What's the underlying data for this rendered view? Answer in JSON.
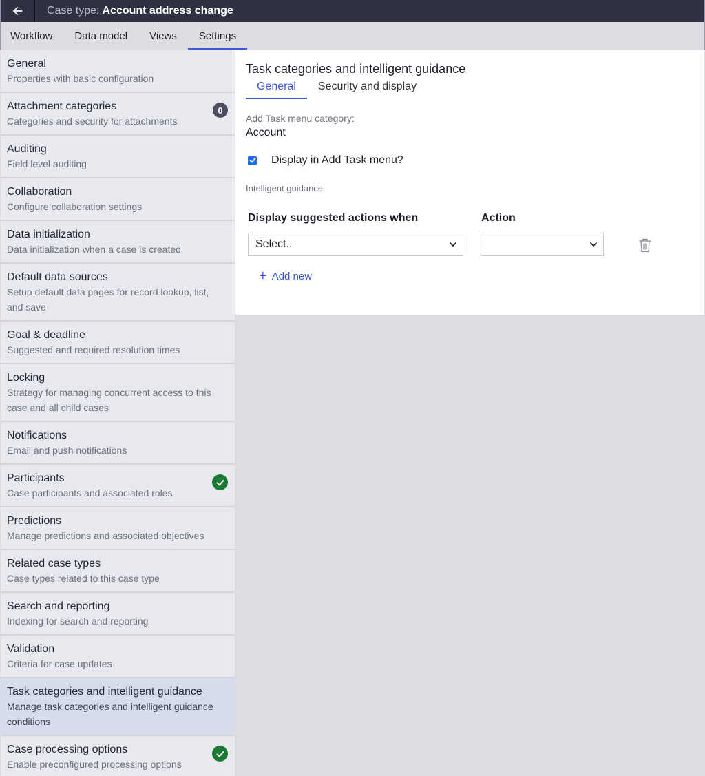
{
  "header": {
    "case_type_label": "Case type:",
    "case_type_name": "Account address change",
    "back_icon": "arrow-left-icon"
  },
  "tabs": [
    {
      "label": "Workflow",
      "active": false
    },
    {
      "label": "Data model",
      "active": false
    },
    {
      "label": "Views",
      "active": false
    },
    {
      "label": "Settings",
      "active": true
    }
  ],
  "sidebar": {
    "items": [
      {
        "title": "General",
        "desc": "Properties with basic configuration"
      },
      {
        "title": "Attachment categories",
        "desc": "Categories and security for attachments",
        "badge_count": "0"
      },
      {
        "title": "Auditing",
        "desc": "Field level auditing"
      },
      {
        "title": "Collaboration",
        "desc": "Configure collaboration settings"
      },
      {
        "title": "Data initialization",
        "desc": "Data initialization when a case is created"
      },
      {
        "title": "Default data sources",
        "desc": "Setup default data pages for record lookup, list, and save"
      },
      {
        "title": "Goal & deadline",
        "desc": "Suggested and required resolution times"
      },
      {
        "title": "Locking",
        "desc": "Strategy for managing concurrent access to this case and all child cases"
      },
      {
        "title": "Notifications",
        "desc": "Email and push notifications"
      },
      {
        "title": "Participants",
        "desc": "Case participants and associated roles",
        "status": "configured"
      },
      {
        "title": "Predictions",
        "desc": "Manage predictions and associated objectives"
      },
      {
        "title": "Related case types",
        "desc": "Case types related to this case type"
      },
      {
        "title": "Search and reporting",
        "desc": "Indexing for search and reporting"
      },
      {
        "title": "Validation",
        "desc": "Criteria for case updates"
      },
      {
        "title": "Task categories and intelligent guidance",
        "desc": "Manage task categories and intelligent guidance conditions",
        "active": true
      },
      {
        "title": "Case processing options",
        "desc": "Enable preconfigured processing options",
        "status": "configured"
      }
    ]
  },
  "panel": {
    "title": "Task categories and intelligent guidance",
    "subtabs": [
      {
        "label": "General",
        "active": true
      },
      {
        "label": "Security and display",
        "active": false
      }
    ],
    "category_label": "Add Task menu category:",
    "category_value": "Account",
    "display_checkbox": {
      "label": "Display in Add Task menu?",
      "checked": true
    },
    "section_label": "Intelligent guidance",
    "columns": {
      "condition": "Display suggested actions when",
      "action": "Action"
    },
    "row": {
      "condition_value": "Select..",
      "action_value": ""
    },
    "add_new_label": "Add new"
  },
  "colors": {
    "accent": "#3b58d6",
    "topbar": "#2d3142",
    "success": "#1a7a33",
    "active_item": "#d6dcec"
  }
}
